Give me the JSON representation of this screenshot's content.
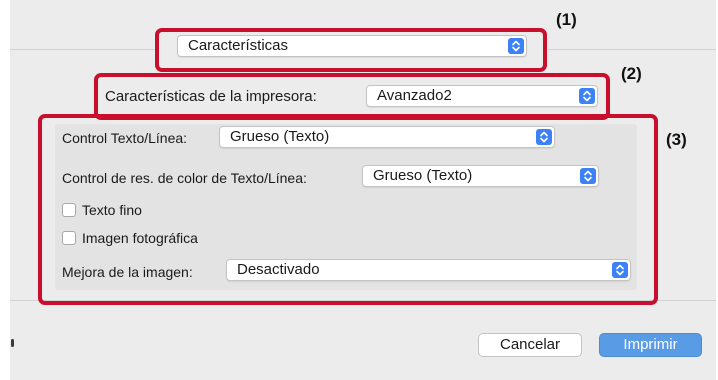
{
  "callouts": {
    "c1": "(1)",
    "c2": "(2)",
    "c3": "(3)"
  },
  "menu_select": {
    "value": "Características"
  },
  "printer_features": {
    "label": "Características de la impresora:",
    "value": "Avanzado2"
  },
  "text_line_control": {
    "label": "Control Texto/Línea:",
    "value": "Grueso (Texto)"
  },
  "color_res_control": {
    "label": "Control de res. de color de Texto/Línea:",
    "value": "Grueso (Texto)"
  },
  "thin_text": {
    "label": "Texto fino",
    "checked": false
  },
  "photo_image": {
    "label": "Imagen fotográfica",
    "checked": false
  },
  "image_enhancement": {
    "label": "Mejora de la imagen:",
    "value": "Desactivado"
  },
  "buttons": {
    "cancel": "Cancelar",
    "print": "Imprimir"
  },
  "colors": {
    "callout_border": "#c8102e",
    "accent": "#3c82f6",
    "print_button": "#5a9be6"
  }
}
